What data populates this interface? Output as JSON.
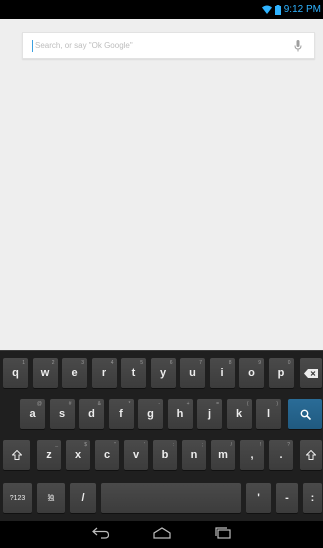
{
  "status_bar": {
    "time": "9:12 PM",
    "icons": [
      "wifi-icon",
      "battery-icon"
    ],
    "accent_color": "#2fb3ff"
  },
  "search": {
    "placeholder": "Search, or say \"Ok Google\"",
    "value": "",
    "icon": "microphone-icon"
  },
  "keyboard": {
    "row1": [
      {
        "label": "q",
        "sub": "1"
      },
      {
        "label": "w",
        "sub": "2"
      },
      {
        "label": "e",
        "sub": "3"
      },
      {
        "label": "r",
        "sub": "4"
      },
      {
        "label": "t",
        "sub": "5"
      },
      {
        "label": "y",
        "sub": "6"
      },
      {
        "label": "u",
        "sub": "7"
      },
      {
        "label": "i",
        "sub": "8"
      },
      {
        "label": "o",
        "sub": "9"
      },
      {
        "label": "p",
        "sub": "0"
      }
    ],
    "row2": [
      {
        "label": "a",
        "sub": "@"
      },
      {
        "label": "s",
        "sub": "#"
      },
      {
        "label": "d",
        "sub": "&"
      },
      {
        "label": "f",
        "sub": "*"
      },
      {
        "label": "g",
        "sub": "-"
      },
      {
        "label": "h",
        "sub": "+"
      },
      {
        "label": "j",
        "sub": "="
      },
      {
        "label": "k",
        "sub": "("
      },
      {
        "label": "l",
        "sub": ")"
      }
    ],
    "row3": [
      {
        "label": "z",
        "sub": "_"
      },
      {
        "label": "x",
        "sub": "$"
      },
      {
        "label": "c",
        "sub": "\""
      },
      {
        "label": "v",
        "sub": "'"
      },
      {
        "label": "b",
        "sub": ":"
      },
      {
        "label": "n",
        "sub": ";"
      },
      {
        "label": "m",
        "sub": "/"
      },
      {
        "label": ",",
        "sub": "!"
      },
      {
        "label": ".",
        "sub": "?"
      }
    ],
    "symbols_label": "?123",
    "settings_label": "独",
    "slash_label": "/",
    "apostrophe_label": "'",
    "dash_label": "-",
    "colon_label": ":",
    "action_color": "#2a6c97"
  },
  "nav_bar": {
    "buttons": [
      "back-icon",
      "home-icon",
      "recent-apps-icon"
    ]
  }
}
